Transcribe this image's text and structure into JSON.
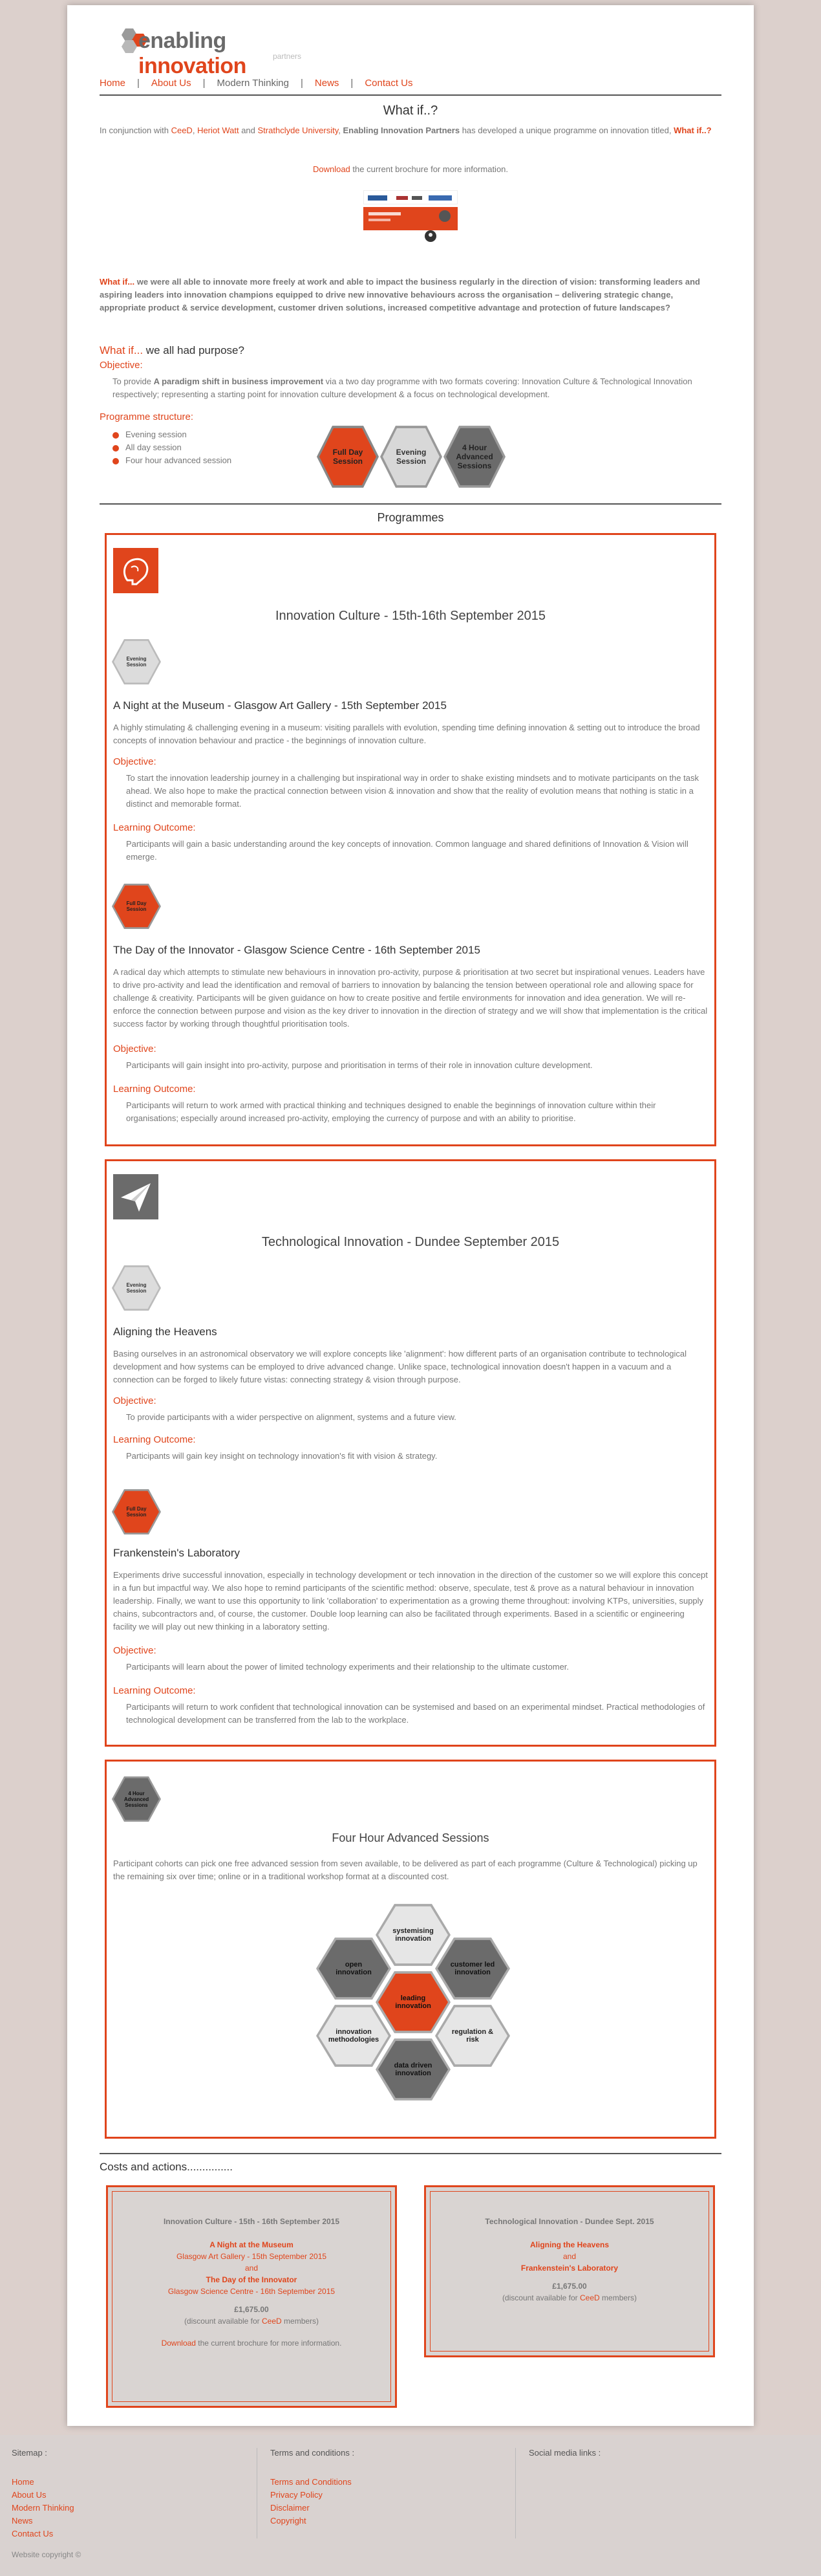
{
  "brand": {
    "name_part1": "enabling",
    "name_part2": "innovation",
    "sub": "partners"
  },
  "nav": {
    "items": [
      "Home",
      "About Us",
      "Modern Thinking",
      "News",
      "Contact Us"
    ],
    "separator": "|"
  },
  "intro": {
    "title": "What if..?",
    "p1_a": "In conjunction with ",
    "p1_link1": "CeeD",
    "p1_b": ", ",
    "p1_link2": "Heriot Watt",
    "p1_c": " and ",
    "p1_link3": "Strathclyde University",
    "p1_d": ", ",
    "p1_bold": "Enabling Innovation Partners",
    "p1_e": " has developed a unique programme on innovation titled, ",
    "p1_link4": "What if..?",
    "download_link": "Download",
    "download_text": " the current brochure for more information.",
    "lead_orange": "What if...",
    "lead_text": " we were all able to innovate more freely at work and able to impact the business regularly in the direction of vision: transforming leaders and aspiring leaders into innovation champions equipped to drive new innovative behaviours across the organisation – delivering strategic change, appropriate product & service development, customer driven solutions, increased competitive advantage and protection of future landscapes?",
    "purpose_orange": "What if...",
    "purpose_text": " we all had purpose?",
    "objective_label": "Objective:",
    "objective_a": "To provide ",
    "objective_bold": "A paradigm shift in business improvement",
    "objective_b": " via a two day programme with two formats covering: Innovation Culture & Technological Innovation respectively; representing a starting point for innovation culture development & a focus on technological development.",
    "structure_label": "Programme structure:",
    "structure_items": [
      "Evening session",
      "All day session",
      "Four hour advanced session"
    ],
    "hex_full": "Full Day Session",
    "hex_evening": "Evening Session",
    "hex_four": "4 Hour Advanced Sessions"
  },
  "programmes_title": "Programmes",
  "culture": {
    "title": "Innovation Culture - 15th-16th September 2015",
    "s1_badge": "Evening Session",
    "s1_title": "A Night at the Museum - Glasgow Art Gallery - 15th September 2015",
    "s1_text": "A highly stimulating & challenging evening in a museum: visiting parallels with evolution, spending time defining innovation & setting out to introduce the broad concepts of innovation behaviour and practice - the beginnings of innovation culture.",
    "s1_obj_label": "Objective:",
    "s1_obj": "To start the innovation leadership journey in a challenging but inspirational way in order to shake existing mindsets and to motivate participants on the task ahead. We also hope to make the practical connection between vision & innovation and show that the reality of evolution means that nothing is static in a distinct and memorable format.",
    "s1_lo_label": "Learning Outcome:",
    "s1_lo": "Participants will gain a basic understanding around the key concepts of innovation. Common language and shared definitions of Innovation & Vision will emerge.",
    "s2_badge": "Full Day Session",
    "s2_title": "The Day of the Innovator - Glasgow Science Centre - 16th September 2015",
    "s2_text": "A radical day which attempts to stimulate new behaviours in innovation pro-activity, purpose & prioritisation at two secret but inspirational venues. Leaders have to drive pro-activity and lead the identification and removal of barriers to innovation by balancing the tension between operational role and allowing space for challenge & creativity. Participants will be given guidance on how to create positive and fertile environments for innovation and idea generation. We will re-enforce the connection between purpose and vision as the key driver to innovation in the direction of strategy and we will show that implementation is the critical success factor by working through thoughtful prioritisation tools.",
    "s2_obj_label": "Objective:",
    "s2_obj": "Participants will gain insight into pro-activity, purpose and prioritisation in terms of their role in innovation culture development.",
    "s2_lo_label": "Learning Outcome:",
    "s2_lo": "Participants will return to work armed with practical thinking and techniques designed to enable the beginnings of innovation culture within their organisations; especially around increased pro-activity, employing the currency of purpose and with an ability to prioritise."
  },
  "tech": {
    "title": "Technological Innovation - Dundee September 2015",
    "s1_badge": "Evening Session",
    "s1_title": "Aligning the Heavens",
    "s1_text": "Basing ourselves in an astronomical observatory we will explore concepts like 'alignment': how different parts of an organisation contribute to technological development and how systems can be employed to drive advanced change. Unlike space, technological innovation doesn't happen in a vacuum and a connection can be forged to likely future vistas: connecting strategy & vision through purpose.",
    "s1_obj_label": "Objective:",
    "s1_obj": "To provide participants with a wider perspective on alignment, systems and a future view.",
    "s1_lo_label": "Learning Outcome:",
    "s1_lo": "Participants will gain key insight on technology innovation's fit with vision & strategy.",
    "s2_badge": "Full Day Session",
    "s2_title": "Frankenstein's Laboratory",
    "s2_text": "Experiments drive successful innovation, especially in technology development or tech innovation in the direction of the customer so we will explore this concept in a fun but impactful way. We also hope to remind participants of the scientific method: observe, speculate, test & prove as a natural behaviour in innovation leadership. Finally, we want to use this opportunity to link 'collaboration' to experimentation as a growing theme throughout: involving KTPs, universities, supply chains, subcontractors and, of course, the customer. Double loop learning can also be facilitated through experiments. Based in a scientific or engineering facility we will play out new thinking in a laboratory setting.",
    "s2_obj_label": "Objective:",
    "s2_obj": "Participants will learn about the power of limited technology experiments and their relationship to the ultimate customer.",
    "s2_lo_label": "Learning Outcome:",
    "s2_lo": "Participants will return to work confident that technological innovation can be systemised and based on an experimental mindset. Practical methodologies of technological development can be transferred from the lab to the workplace."
  },
  "advanced": {
    "badge": "4 Hour Advanced Sessions",
    "title": "Four Hour Advanced Sessions",
    "text": "Participant cohorts can pick one free advanced session from seven available, to be delivered as part of each programme (Culture & Technological) picking up the remaining six over time; online or in a traditional workshop format at a discounted cost.",
    "hexes": [
      "systemising innovation",
      "open innovation",
      "customer led innovation",
      "leading innovation",
      "innovation methodologies",
      "regulation & risk",
      "data driven innovation"
    ]
  },
  "costs": {
    "title": "Costs and actions...............",
    "box1": {
      "head": "Innovation Culture - 15th - 16th September 2015",
      "l1": "A Night at the Museum",
      "l2": "Glasgow Art Gallery - 15th September 2015",
      "l3": "and",
      "l4": "The Day of the Innovator",
      "l5": "Glasgow Science Centre - 16th September 2015",
      "price": "£1,675.00",
      "disc_a": "(discount available for ",
      "disc_link": "CeeD",
      "disc_b": " members)",
      "dl_link": "Download",
      "dl_text": " the current brochure for more information."
    },
    "box2": {
      "head": "Technological Innovation - Dundee Sept. 2015",
      "l1": "Aligning the Heavens",
      "l2": "and",
      "l3": "Frankenstein's Laboratory",
      "price": "£1,675.00",
      "disc_a": "(discount available for ",
      "disc_link": "CeeD",
      "disc_b": " members)"
    }
  },
  "footer": {
    "sitemap_head": "Sitemap :",
    "sitemap": [
      "Home",
      "About Us",
      "Modern Thinking",
      "News",
      "Contact Us"
    ],
    "terms_head": "Terms and conditions :",
    "terms": [
      "Terms and Conditions",
      "Privacy Policy",
      "Disclaimer",
      "Copyright"
    ],
    "social_head": "Social media links :",
    "copyright": "Website copyright ©"
  },
  "colors": {
    "accent": "#e0451c",
    "dark_hex": "#6b6b6b",
    "light_hex": "#d6d6d6"
  }
}
